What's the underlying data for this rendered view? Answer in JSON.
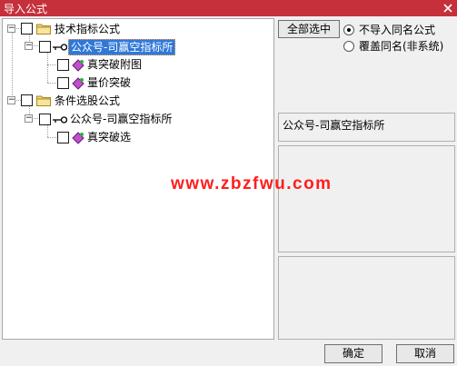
{
  "window": {
    "title": "导入公式"
  },
  "tree": {
    "nodes": [
      {
        "label": "技术指标公式",
        "children": [
          {
            "label": "公众号-司赢空指标所",
            "selected": true,
            "children": [
              {
                "label": "真突破附图"
              },
              {
                "label": "量价突破"
              }
            ]
          }
        ]
      },
      {
        "label": "条件选股公式",
        "children": [
          {
            "label": "公众号-司赢空指标所",
            "children": [
              {
                "label": "真突破选"
              }
            ]
          }
        ]
      }
    ]
  },
  "options": {
    "select_all_label": "全部选中",
    "radio_no_import": "不导入同名公式",
    "radio_overwrite": "覆盖同名(非系统)",
    "radio_selected": "no_import"
  },
  "details": {
    "author": "公众号-司赢空指标所"
  },
  "watermark": {
    "text": "www.zbzfwu.com"
  },
  "buttons": {
    "ok": "确定",
    "cancel": "取消"
  },
  "colors": {
    "titlebar": "#c6303b",
    "selection": "#3078d8",
    "watermark": "#ff1e1e"
  }
}
